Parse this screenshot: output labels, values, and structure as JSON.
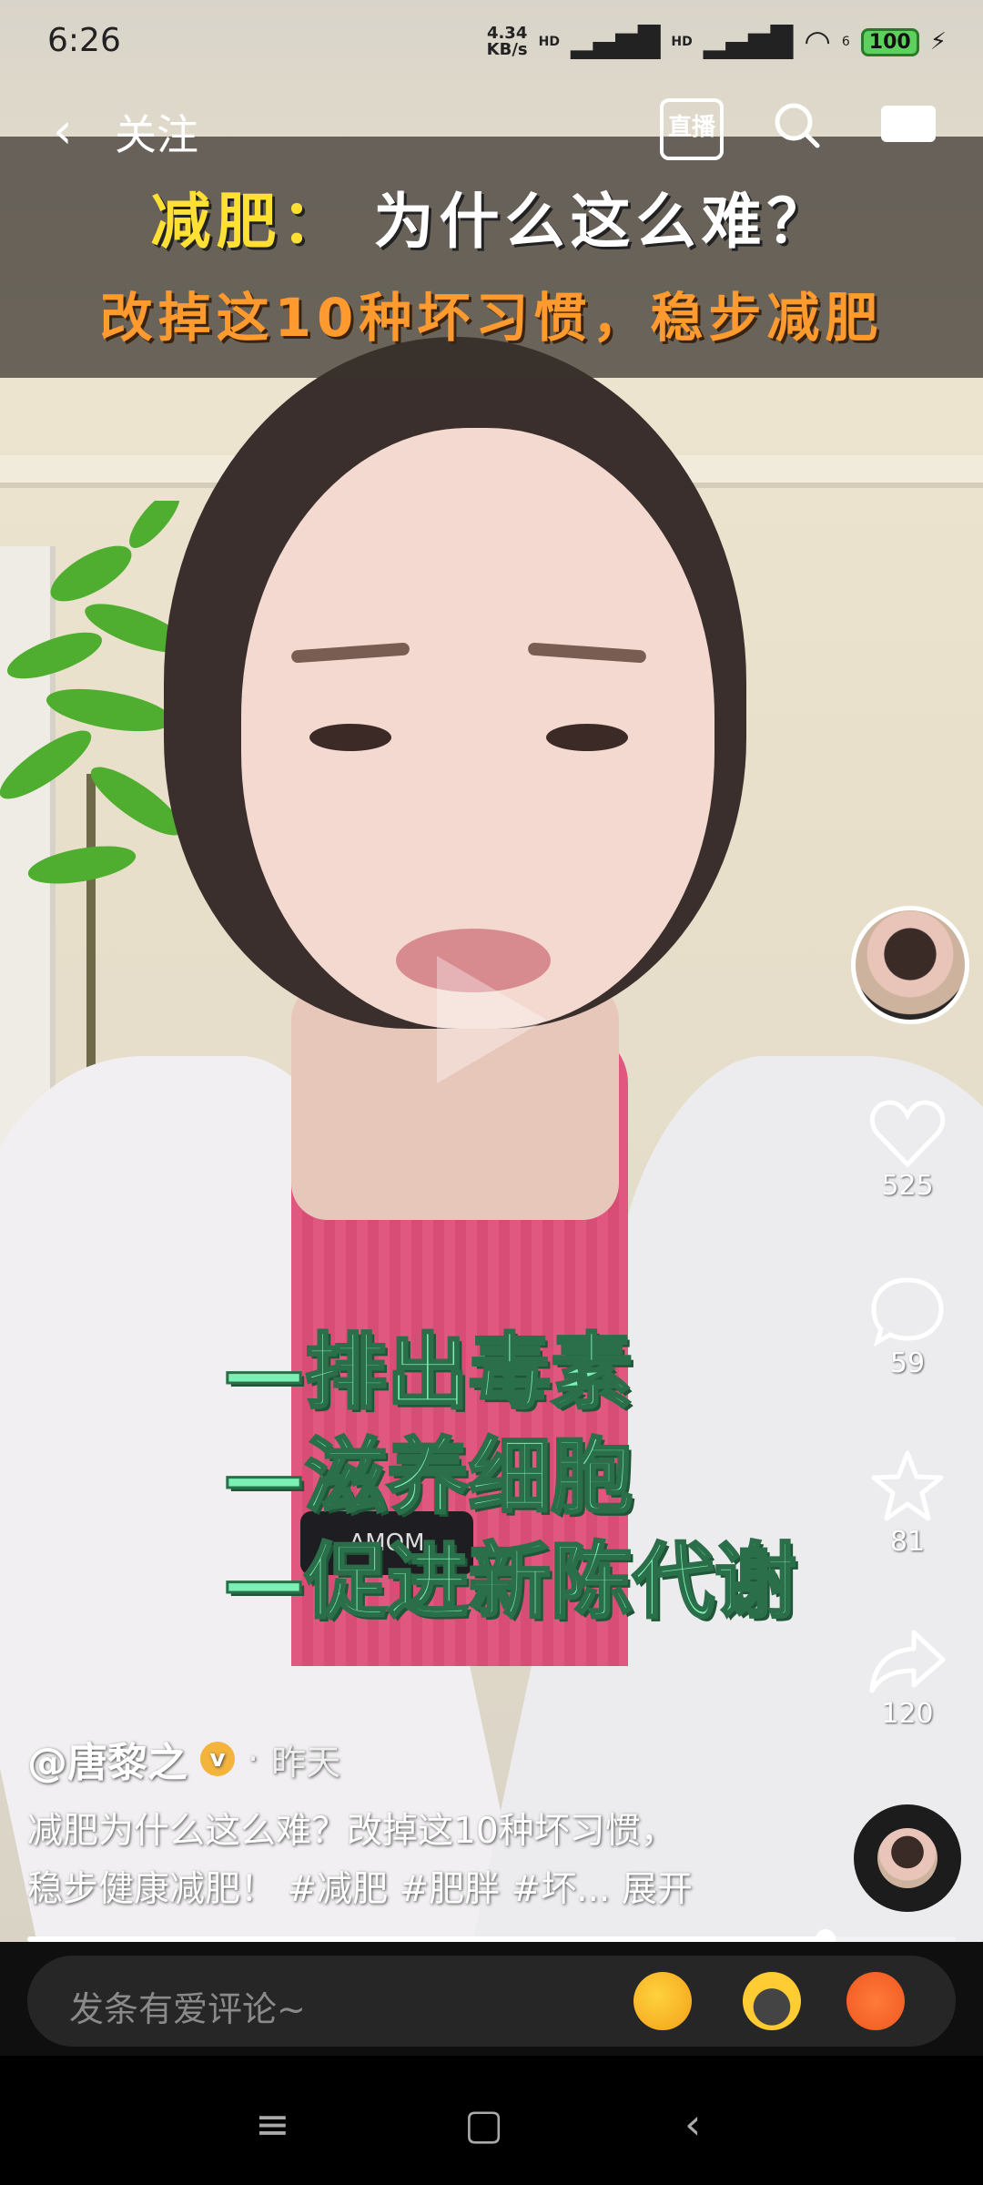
{
  "status_bar": {
    "time": "6:26",
    "net_speed_value": "4.34",
    "net_speed_unit": "KB/s",
    "hd1": "HD",
    "hd2": "HD",
    "wifi_badge": "6",
    "battery": "100"
  },
  "top_nav": {
    "back_icon": "chevron-left-icon",
    "follow_label": "关注",
    "live_label": "直播",
    "search_icon": "search-icon",
    "screen_icon": "cast-screen-icon"
  },
  "video": {
    "title_highlight": "减肥：",
    "title_rest": "为什么这么难？",
    "subtitle": "改掉这10种坏习惯，稳步减肥",
    "overlay_lines": [
      "—排出毒素",
      "—滋养细胞",
      "—促进新陈代谢"
    ],
    "mic_text": "AMOM"
  },
  "rail": {
    "like_count": "525",
    "comment_count": "59",
    "favorite_count": "81",
    "share_count": "120"
  },
  "post": {
    "author": "@唐黎之",
    "separator": "·",
    "time_ago": "昨天",
    "caption_line1": "减肥为什么这么难？改掉这10种坏习惯，",
    "caption_line2": "稳步健康减肥！ #减肥 #肥胖 #坏...",
    "expand_label": "展开"
  },
  "progress": {
    "fraction": 0.86
  },
  "comment": {
    "placeholder": "发条有爱评论~",
    "emojis": [
      "blowing-kiss-emoji",
      "frying-pan-emoji",
      "thermometer-sick-emoji"
    ]
  },
  "colors": {
    "title_highlight": "#ffe033",
    "subtitle": "#ff9a2e",
    "overlay_text": "#7cf0b4"
  }
}
